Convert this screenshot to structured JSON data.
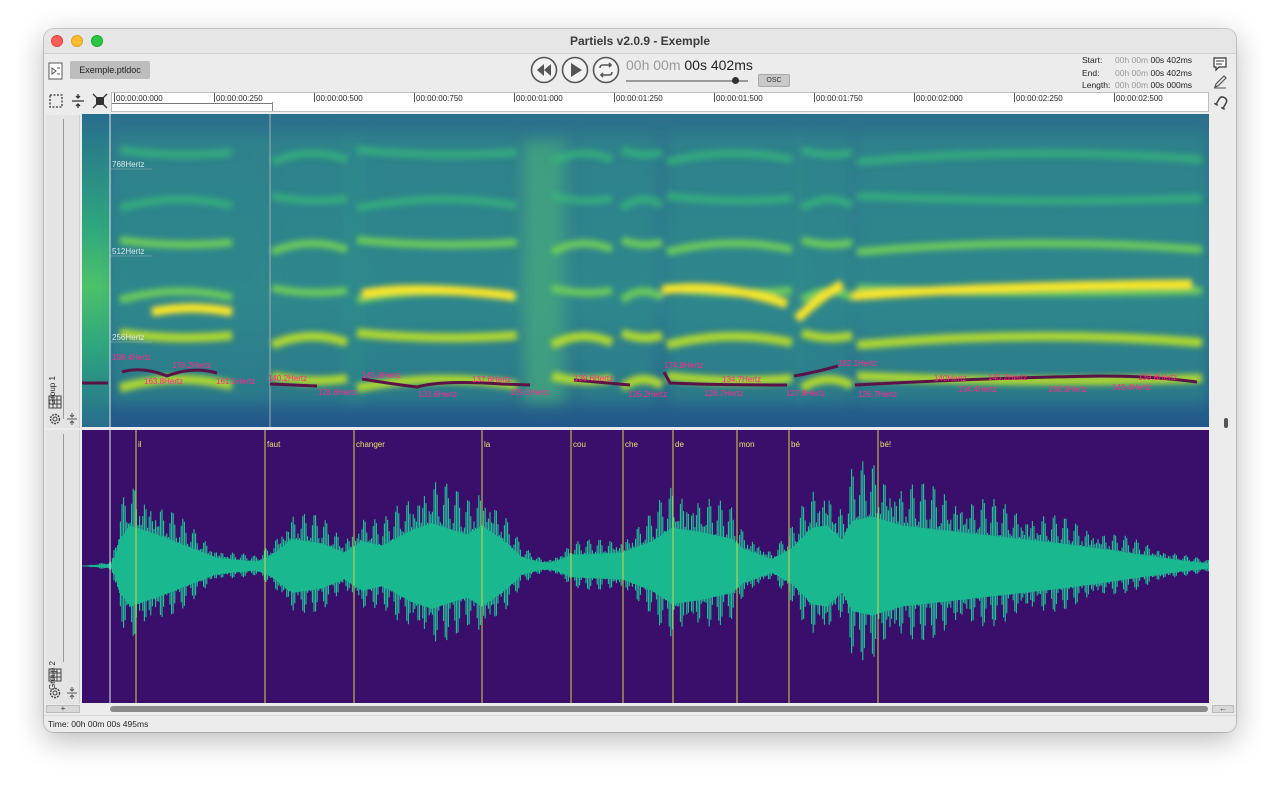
{
  "window": {
    "title": "Partiels v2.0.9 - Exemple",
    "document_tab": "Exemple.ptldoc",
    "accent_spectrogram": "#2a788e",
    "accent_wave_bg": "#3a0f6b",
    "accent_wave": "#1fc79a",
    "accent_label": "#ff2a8a"
  },
  "transport": {
    "rewind_icon": "rewind-icon",
    "play_icon": "play-icon",
    "loop_icon": "loop-icon",
    "time_hours": "00h",
    "time_minutes": "00m",
    "time_seconds": "00s",
    "time_ms": "402ms",
    "volume_level": 0.86,
    "osc_label": "OSC"
  },
  "selection": {
    "start_label": "Start:",
    "start_dim": "00h 00m",
    "start_val": "00s 402ms",
    "end_label": "End:",
    "end_dim": "00h 00m",
    "end_val": "00s 402ms",
    "length_label": "Length:",
    "length_dim": "00h 00m",
    "length_val": "00s 000ms"
  },
  "ruler": {
    "ticks": [
      "00:00:00:000",
      "00:00:00:250",
      "00:00:00:500",
      "00:00:00:750",
      "00:00:01:000",
      "00:00:01:250",
      "00:00:01:500",
      "00:00:01:750",
      "00:00:02:000",
      "00:00:02:250",
      "00:00:02:500"
    ]
  },
  "groups": [
    {
      "name": "Group 1"
    },
    {
      "name": "Group 2"
    }
  ],
  "spectrogram": {
    "freq_labels": [
      "768Hertz",
      "512Hertz",
      "256Hertz"
    ],
    "pitch_labels": [
      "198.4Hertz",
      "178.2Hertz",
      "163.8Hertz",
      "161.1Hertz",
      "140.2Hertz",
      "128.6Hertz",
      "145.8Hertz",
      "137.6Hertz",
      "133.6Hertz",
      "129.1Hertz",
      "139.6Hertz",
      "126.2Hertz",
      "174.8Hertz",
      "134.7Hertz",
      "128.7Hertz",
      "127.8Hertz",
      "182.1Hertz",
      "126.7Hertz",
      "140Hertz",
      "145.2Hertz",
      "134.4Hertz",
      "138.5Hertz",
      "149.4Hertz",
      "139.8Hertz"
    ]
  },
  "waveform": {
    "markers": [
      "il",
      "faut",
      "changer",
      "la",
      "cou",
      "che",
      "de",
      "mon",
      "bé",
      "bé!"
    ]
  },
  "status": {
    "time_text": "Time: 00h 00m 00s 495ms"
  },
  "zoom": {
    "plus_label": "+",
    "minus_label": "←"
  }
}
